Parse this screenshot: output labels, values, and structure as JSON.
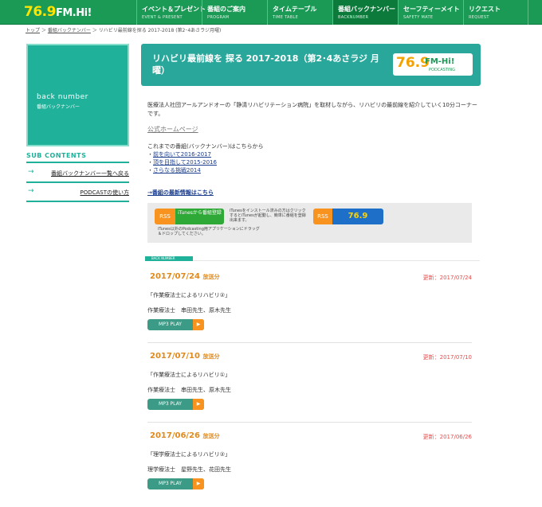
{
  "header": {
    "logo_num": "76.9",
    "logo_text": "FM.Hi!",
    "nav": [
      {
        "jp": "イベント＆プレゼント",
        "en": "EVENT & PRESENT"
      },
      {
        "jp": "番組のご案内",
        "en": "PROGRAM"
      },
      {
        "jp": "タイムテーブル",
        "en": "TIME TABLE"
      },
      {
        "jp": "番組バックナンバー",
        "en": "BACKNUMBER"
      },
      {
        "jp": "セーフティーメイト",
        "en": "SAFETY MATE"
      },
      {
        "jp": "リクエスト",
        "en": "REQUEST"
      }
    ]
  },
  "breadcrumb": {
    "home": "トップ",
    "sep1": " ＞ ",
    "section": "番組バックナンバー",
    "sep2": " ＞ ",
    "current": "リハビリ最前線を探る 2017-2018 (第2･4あさラジ月曜)"
  },
  "sidebar": {
    "hero_title": "back number",
    "hero_sub": "番組バックナンバー",
    "sub_title": "sub contents",
    "items": [
      {
        "label": "番組バックナンバー一覧へ戻る"
      },
      {
        "label": "PODCASTの使い方"
      }
    ]
  },
  "main": {
    "title": "リハビリ最前線を 探る 2017-2018（第2･4あさラジ 月曜）",
    "banner_logo_num": "76.9",
    "banner_logo_fm": "FM-Hi!",
    "banner_logo_pod": "PODCASTING",
    "description": "医療法人社団アールアンドオーの「静清リハビリテーション病院」を取材しながら、リハビリの最前線を紹介していく10分コーナーです。",
    "official_link": "公式ホームページ",
    "past_intro": "これまでの番組(バックナンバー)はこちらから",
    "past_links": [
      "前を向いて2016-2017",
      "頂を目指して2015-2016",
      "さらなる挑戦2014"
    ],
    "latest_link": "→番組の最新情報はこちら"
  },
  "podcast": {
    "rss": "RSS",
    "itunes_label": "iTunesから番組登録",
    "itunes_note": "iTunesをインストール済みの方はクリックするとiTunesが起動し、簡単に番組を登録出来ます。",
    "rss2": "RSS",
    "logo_num": "76.9",
    "other_note": "iTunes以外のPodcasting用アプリケーションにドラッグ＆ドロップしてください。"
  },
  "back_number_label": "BACK NUMBER",
  "episodes": [
    {
      "date": "2017/07/24",
      "suffix": "放送分",
      "updated": "更新：2017/07/24",
      "title": "「作業療法士によるリハビリ②」",
      "people": "作業療法士　串田先生、原木先生",
      "play": "MP3 PLAY",
      "play_icon": "▶"
    },
    {
      "date": "2017/07/10",
      "suffix": "放送分",
      "updated": "更新：2017/07/10",
      "title": "「作業療法士によるリハビリ①」",
      "people": "作業療法士　串田先生、原木先生",
      "play": "MP3 PLAY",
      "play_icon": "▶"
    },
    {
      "date": "2017/06/26",
      "suffix": "放送分",
      "updated": "更新：2017/06/26",
      "title": "「理学療法士によるリハビリ②」",
      "people": "理学療法士　星野先生、花田先生",
      "play": "MP3 PLAY",
      "play_icon": "▶"
    }
  ]
}
